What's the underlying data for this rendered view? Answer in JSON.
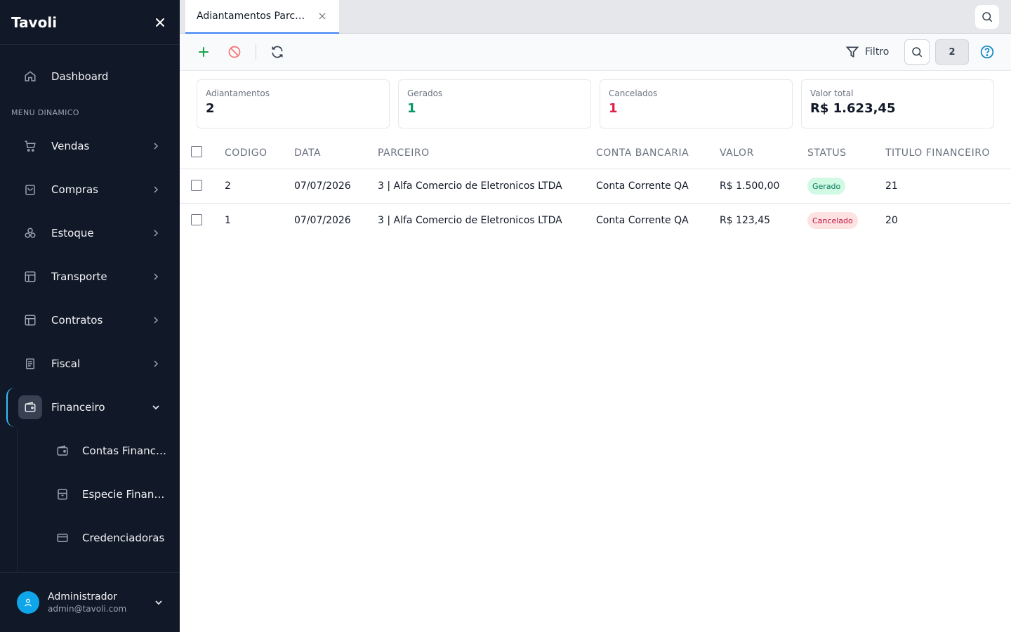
{
  "app": {
    "brand": "Tavoli"
  },
  "sidebar": {
    "dashboard_label": "Dashboard",
    "section_label": "MENU DINAMICO",
    "items": [
      {
        "label": "Vendas",
        "icon": "cart-icon"
      },
      {
        "label": "Compras",
        "icon": "shopping-bag-icon"
      },
      {
        "label": "Estoque",
        "icon": "boxes-icon"
      },
      {
        "label": "Transporte",
        "icon": "layout-icon"
      },
      {
        "label": "Contratos",
        "icon": "layout-icon"
      },
      {
        "label": "Fiscal",
        "icon": "document-icon"
      },
      {
        "label": "Financeiro",
        "icon": "wallet-icon"
      }
    ],
    "sub_items": [
      {
        "label": "Contas Financeiras",
        "icon": "wallet-icon"
      },
      {
        "label": "Especie Financeira",
        "icon": "archive-icon"
      },
      {
        "label": "Credenciadoras",
        "icon": "credit-card-icon"
      }
    ],
    "user": {
      "name": "Administrador",
      "email": "admin@tavoli.com"
    }
  },
  "tabs": [
    {
      "label": "Adiantamentos Parceiros"
    }
  ],
  "toolbar": {
    "filter_label": "Filtro",
    "count": "2"
  },
  "cards": [
    {
      "label": "Adiantamentos",
      "value": "2",
      "color": "#111827"
    },
    {
      "label": "Gerados",
      "value": "1",
      "color": "#059669"
    },
    {
      "label": "Cancelados",
      "value": "1",
      "color": "#e11d48"
    },
    {
      "label": "Valor total",
      "value": "R$ 1.623,45",
      "color": "#111827"
    }
  ],
  "table": {
    "columns": [
      "CODIGO",
      "DATA",
      "PARCEIRO",
      "CONTA BANCARIA",
      "VALOR",
      "STATUS",
      "TITULO FINANCEIRO"
    ],
    "rows": [
      {
        "codigo": "2",
        "data": "07/07/2026",
        "parceiro": "3 | Alfa Comercio de Eletronicos LTDA",
        "conta": "Conta Corrente QA",
        "valor": "R$ 1.500,00",
        "status": "Gerado",
        "titulo": "21"
      },
      {
        "codigo": "1",
        "data": "07/07/2026",
        "parceiro": "3 | Alfa Comercio de Eletronicos LTDA",
        "conta": "Conta Corrente QA",
        "valor": "R$ 123,45",
        "status": "Cancelado",
        "titulo": "20"
      }
    ]
  }
}
